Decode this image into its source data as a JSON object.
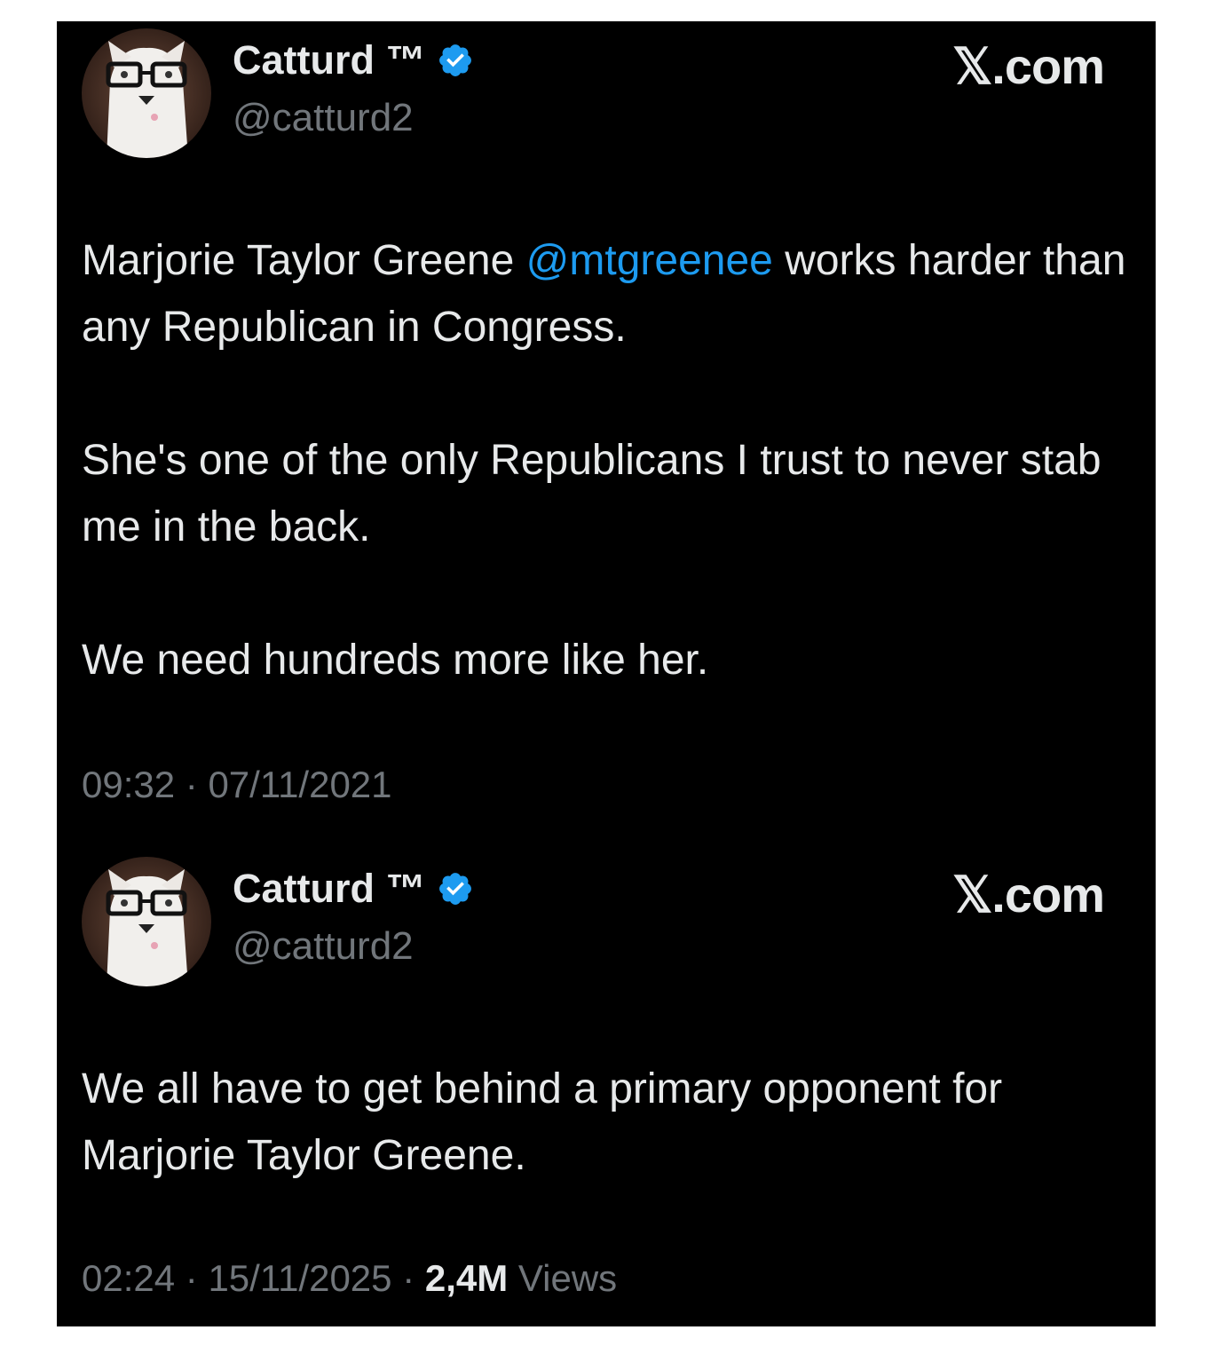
{
  "tweets": [
    {
      "display_name": "Catturd ™",
      "handle": "@catturd2",
      "brand": "𝕏.com",
      "body_parts": {
        "before_mention": "Marjorie Taylor Greene ",
        "mention": "@mtgreenee",
        "after_mention": " works harder than any Republican in Congress."
      },
      "paragraph_2": "She's one of the only Republicans I trust to never stab me in the back.",
      "paragraph_3": "We need hundreds more like her.",
      "time": "09:32",
      "date": "07/11/2021",
      "separator": " · "
    },
    {
      "display_name": "Catturd ™",
      "handle": "@catturd2",
      "brand": "𝕏.com",
      "paragraph_1": "We all have to get behind a primary opponent for Marjorie Taylor Greene.",
      "time": "02:24",
      "date": "15/11/2025",
      "separator": " · ",
      "views_count": "2,4M",
      "views_label": " Views"
    }
  ],
  "colors": {
    "background": "#000000",
    "text": "#e7e9ea",
    "muted": "#71767b",
    "mention": "#1d9bf0",
    "verified_badge": "#1d9bf0"
  },
  "icons": {
    "verified": "verified-badge-icon",
    "avatar": "cat-with-glasses-avatar"
  }
}
